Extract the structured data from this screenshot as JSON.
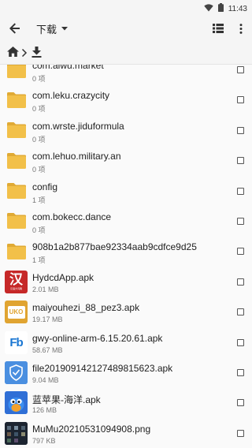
{
  "status_bar": {
    "time": "11:43",
    "icons": [
      "wifi-icon",
      "battery-icon"
    ]
  },
  "app_bar": {
    "title": "下载",
    "icons": [
      "back-arrow-icon",
      "dropdown-caret-icon",
      "list-view-icon",
      "more-vert-icon"
    ]
  },
  "breadcrumb": {
    "icons": [
      "home-icon",
      "chevron-right-icon",
      "download-icon"
    ]
  },
  "files": [
    {
      "name": "com.aiwu.market",
      "meta": "0 项",
      "kind": "folder"
    },
    {
      "name": "com.leku.crazycity",
      "meta": "0 项",
      "kind": "folder"
    },
    {
      "name": "com.wrste.jiduformula",
      "meta": "0 项",
      "kind": "folder"
    },
    {
      "name": "com.lehuo.military.an",
      "meta": "0 项",
      "kind": "folder"
    },
    {
      "name": "config",
      "meta": "1 项",
      "kind": "folder"
    },
    {
      "name": "com.bokecc.dance",
      "meta": "0 项",
      "kind": "folder"
    },
    {
      "name": "908b1a2b877bae92334aab9cdfce9d25",
      "meta": "1 项",
      "kind": "folder"
    },
    {
      "name": "HydcdApp.apk",
      "meta": "2.01 MB",
      "kind": "apk",
      "icon": "hanyu-dictionary-app-icon",
      "icon_glyph": "汉",
      "icon_sub": "汉语大词典",
      "icon_color": "#c62828"
    },
    {
      "name": "maiyouhezi_88_pez3.apk",
      "meta": "19.17 MB",
      "kind": "apk",
      "icon": "maiyou-box-app-icon",
      "icon_glyph": "UKO",
      "icon_sub": "",
      "icon_color": "#e0a431"
    },
    {
      "name": "gwy-online-arm-6.15.20.61.apk",
      "meta": "58.67 MB",
      "kind": "apk",
      "icon": "fb-app-icon",
      "icon_glyph": "Fb",
      "icon_sub": "",
      "icon_color": "#ffffff"
    },
    {
      "name": "file20190914212748981562​3.apk",
      "meta": "9.04 MB",
      "kind": "apk",
      "icon": "shield-app-icon",
      "icon_glyph": "",
      "icon_sub": "",
      "icon_color": "#4a8fe0"
    },
    {
      "name": "蓝苹果-海洋.apk",
      "meta": "126 MB",
      "kind": "apk",
      "icon": "blue-bird-app-icon",
      "icon_glyph": "",
      "icon_sub": "",
      "icon_color": "#2f6fd6"
    },
    {
      "name": "MuMu20210531094908.png",
      "meta": "797 KB",
      "kind": "image",
      "icon": "screenshot-thumbnail-icon",
      "icon_glyph": "",
      "icon_sub": "",
      "icon_color": "#1c2430"
    }
  ],
  "colors": {
    "folder": "#f2c049",
    "folder_tab": "#e0aa35",
    "accent": "#424242"
  }
}
